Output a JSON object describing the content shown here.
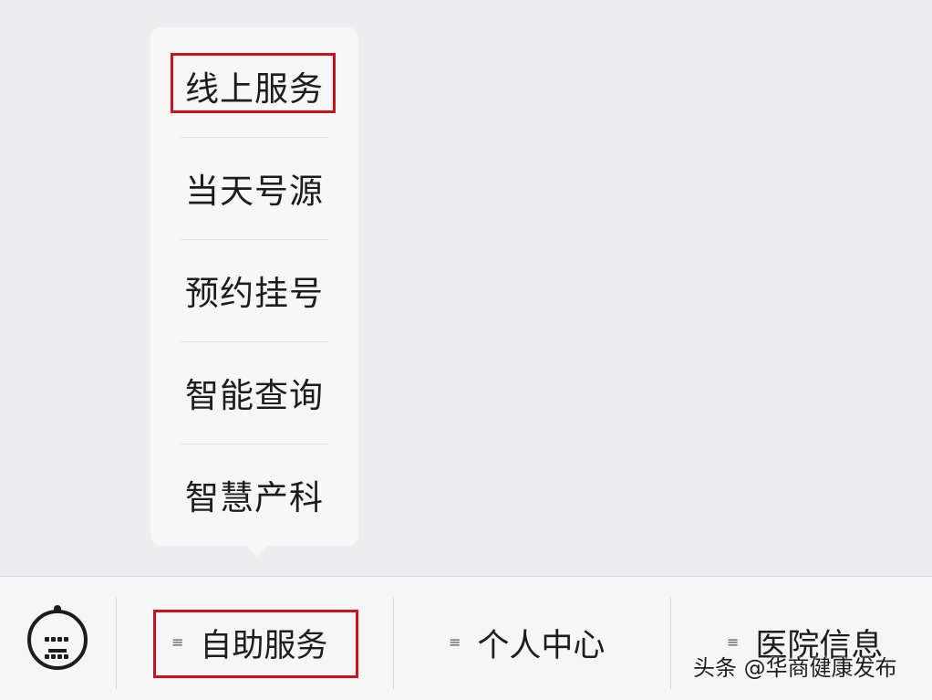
{
  "popup_menu": {
    "items": [
      {
        "label": "线上服务"
      },
      {
        "label": "当天号源"
      },
      {
        "label": "预约挂号"
      },
      {
        "label": "智能查询"
      },
      {
        "label": "智慧产科"
      }
    ]
  },
  "bottom_bar": {
    "keyboard_toggle": {
      "icon": "keyboard-icon"
    },
    "tabs": [
      {
        "label": "自助服务",
        "icon": "menu-icon"
      },
      {
        "label": "个人中心",
        "icon": "menu-icon"
      },
      {
        "label": "医院信息",
        "icon": "menu-icon"
      }
    ]
  },
  "highlight_color": "#c8141a",
  "watermark": "头条 @华商健康发布"
}
